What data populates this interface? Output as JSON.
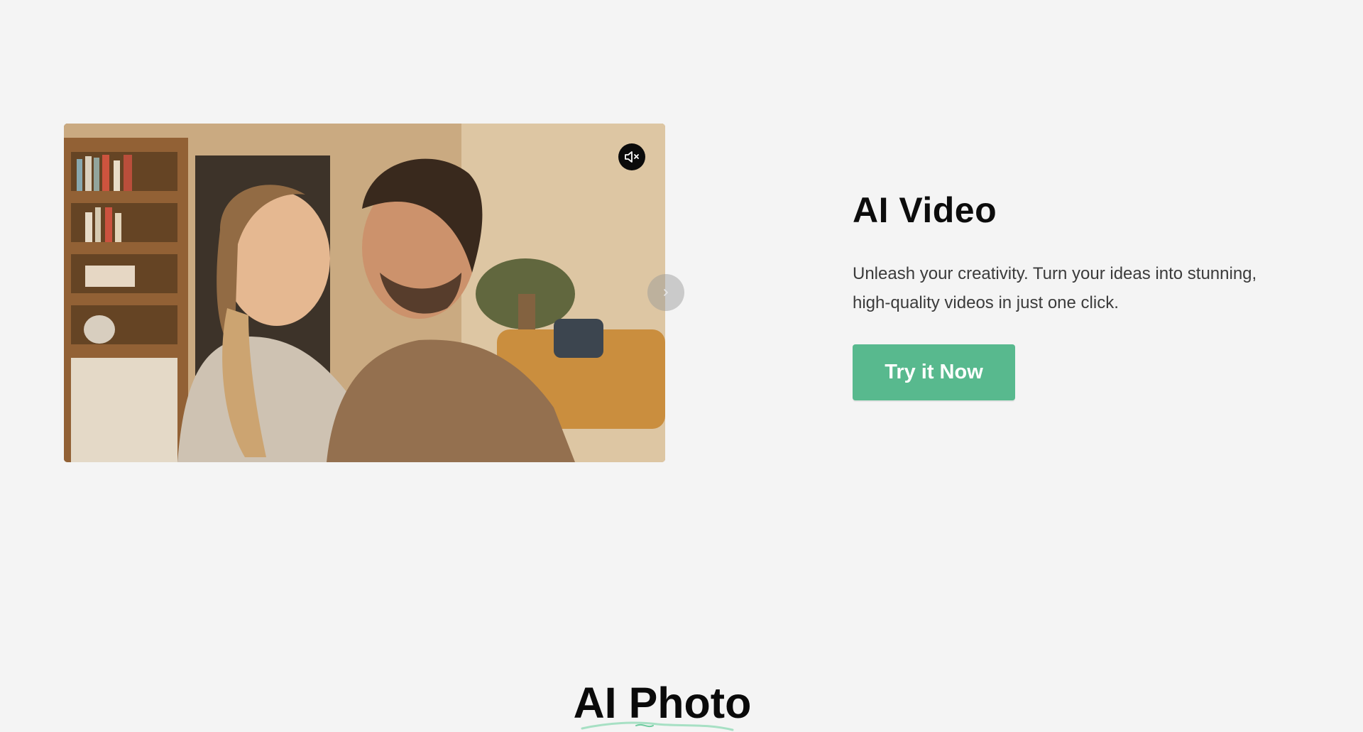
{
  "ai_video": {
    "title": "AI Video",
    "description": "Unleash your creativity. Turn your ideas into stunning, high-quality videos in just one click.",
    "cta_label": "Try it Now"
  },
  "carousel": {
    "icons": {
      "mute": "speaker-muted-icon",
      "next": "chevron-right-icon"
    }
  },
  "ai_photo": {
    "title": "AI Photo"
  },
  "colors": {
    "background": "#f4f4f4",
    "accent": "#58b98e",
    "heading": "#0c0c0c",
    "body_text": "#3b3b3b"
  }
}
